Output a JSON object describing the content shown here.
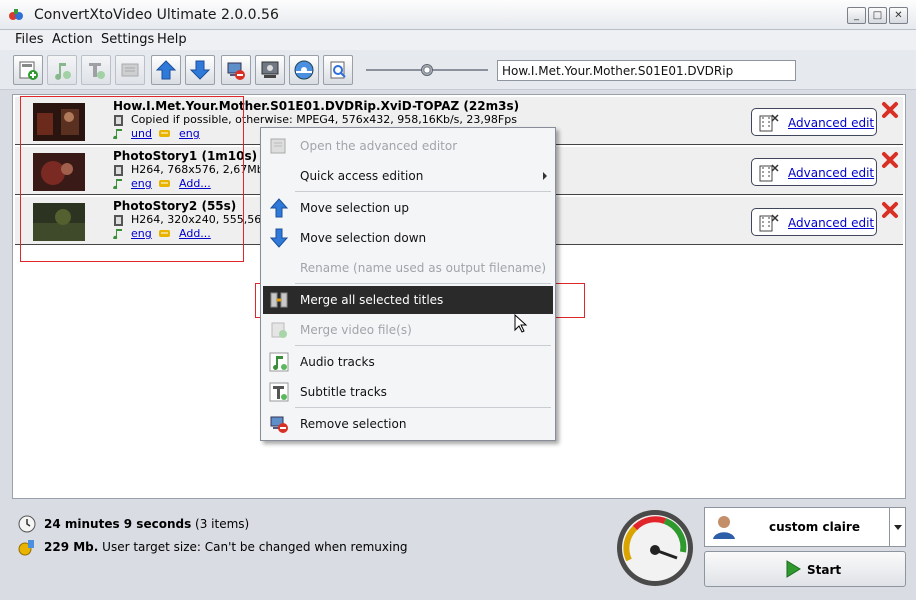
{
  "window": {
    "title": "ConvertXtoVideo Ultimate 2.0.0.56",
    "controls": {
      "minimize": "_",
      "maximize": "□",
      "close": "✕"
    }
  },
  "menu": [
    "Files",
    "Action",
    "Settings",
    "Help"
  ],
  "toolbar": {
    "buttons": [
      "add-video-icon",
      "add-audio-icon",
      "add-subtitle-icon",
      "add-chapter-icon",
      "move-up-icon",
      "move-down-icon",
      "remove-icon",
      "settings-icon",
      "burn-disc-icon",
      "preview-icon"
    ],
    "output_name": "How.I.Met.Your.Mother.S01E01.DVDRip",
    "zoom": 0.5
  },
  "titles": [
    {
      "title": "How.I.Met.Your.Mother.S01E01.DVDRip.XviD-TOPAZ (22m3s)",
      "info": "Copied if possible, otherwise: MPEG4, 576x432, 958,16Kb/s, 23,98Fps",
      "audio": "und",
      "subtitle": "eng",
      "action": "Advanced edit"
    },
    {
      "title": "PhotoStory1 (1m10s)",
      "info": "H264, 768x576, 2,67Mb/s,",
      "audio": "eng",
      "subtitle": "Add...",
      "action": "Advanced edit"
    },
    {
      "title": "PhotoStory2 (55s)",
      "info": "H264, 320x240, 555,56Kb,",
      "audio": "eng",
      "subtitle": "Add...",
      "action": "Advanced edit"
    }
  ],
  "context_menu": {
    "open_editor": "Open the advanced editor",
    "quick_access": "Quick access edition",
    "move_up": "Move selection up",
    "move_down": "Move selection down",
    "rename": "Rename (name used as output filename)",
    "merge_titles": "Merge all selected titles",
    "merge_files": "Merge video file(s)",
    "audio_tracks": "Audio tracks",
    "subtitle_tracks": "Subtitle tracks",
    "remove": "Remove selection"
  },
  "status": {
    "duration": "24 minutes 9 seconds",
    "items": "(3 items)",
    "size": "229 Mb.",
    "size_note": "User target size: Can't be changed when remuxing"
  },
  "profile": {
    "name": "custom claire"
  },
  "start": {
    "label": "Start"
  },
  "colors": {
    "highlight": "#e0262a",
    "menu_active": "#2a2a2a",
    "link": "#0000cc"
  }
}
